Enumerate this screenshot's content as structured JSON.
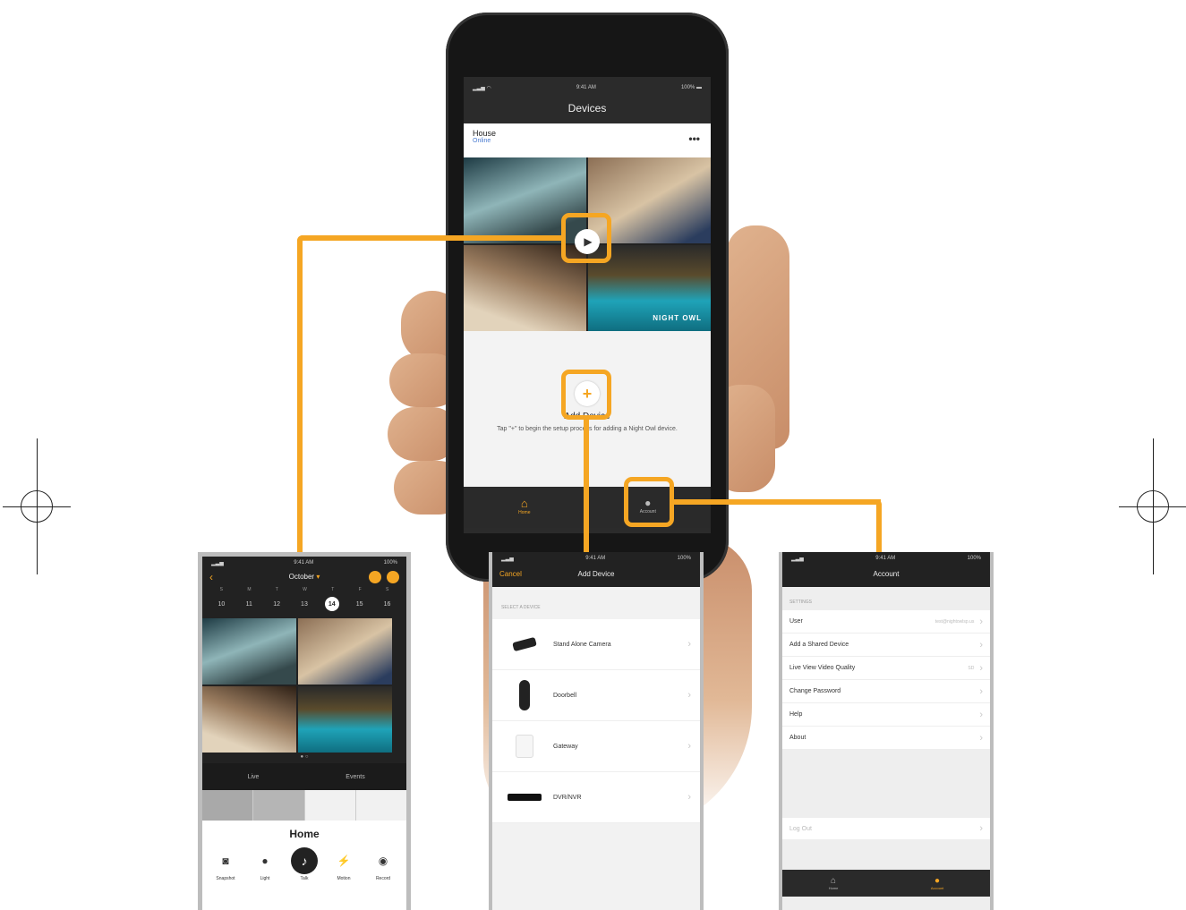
{
  "colors": {
    "accent": "#f5a623",
    "phone_dark": "#1b1b1b",
    "nav_bar": "#2a2a2a"
  },
  "main_phone": {
    "status": {
      "time": "9:41 AM",
      "battery": "100%"
    },
    "title": "Devices",
    "device": {
      "name": "House",
      "status": "Online"
    },
    "add_device": {
      "title": "Add Device",
      "description": "Tap \"+\" to begin the setup process for adding a Night Owl device."
    },
    "tabs": [
      {
        "label": "Home",
        "icon": "home-icon"
      },
      {
        "label": "Account",
        "icon": "person-icon"
      }
    ],
    "watermark": "NIGHT OWL"
  },
  "left_screen": {
    "status": {
      "time": "9:41 AM",
      "battery": "100%"
    },
    "month": "October",
    "weekdays": [
      "S",
      "M",
      "T",
      "W",
      "T",
      "F",
      "S"
    ],
    "days": [
      "10",
      "11",
      "12",
      "13",
      "14",
      "15",
      "16"
    ],
    "selected_day": "14",
    "tabs": [
      "Live",
      "Events"
    ],
    "room": "Home",
    "actions": [
      {
        "label": "Snapshot",
        "icon": "camera-icon"
      },
      {
        "label": "Light",
        "icon": "bulb-icon"
      },
      {
        "label": "Talk",
        "icon": "mic-icon"
      },
      {
        "label": "Motion",
        "icon": "motion-icon"
      },
      {
        "label": "Record",
        "icon": "record-icon"
      }
    ]
  },
  "middle_screen": {
    "status": {
      "time": "9:41 AM",
      "battery": "100%"
    },
    "cancel": "Cancel",
    "title": "Add Device",
    "section": "SELECT A DEVICE",
    "items": [
      {
        "label": "Stand Alone Camera",
        "icon": "camera-device-icon"
      },
      {
        "label": "Doorbell",
        "icon": "doorbell-icon"
      },
      {
        "label": "Gateway",
        "icon": "gateway-icon"
      },
      {
        "label": "DVR/NVR",
        "icon": "dvr-icon"
      }
    ]
  },
  "right_screen": {
    "status": {
      "time": "9:41 AM",
      "battery": "100%"
    },
    "title": "Account",
    "section": "SETTINGS",
    "rows": [
      {
        "label": "User",
        "value": "test@nightowlsp.us"
      },
      {
        "label": "Add a Shared Device",
        "value": ""
      },
      {
        "label": "Live View Video Quality",
        "value": "SD"
      },
      {
        "label": "Change Password",
        "value": ""
      },
      {
        "label": "Help",
        "value": ""
      },
      {
        "label": "About",
        "value": ""
      }
    ],
    "logout": "Log Out",
    "tabs": [
      {
        "label": "Home",
        "icon": "home-icon"
      },
      {
        "label": "Account",
        "icon": "person-icon"
      }
    ]
  }
}
